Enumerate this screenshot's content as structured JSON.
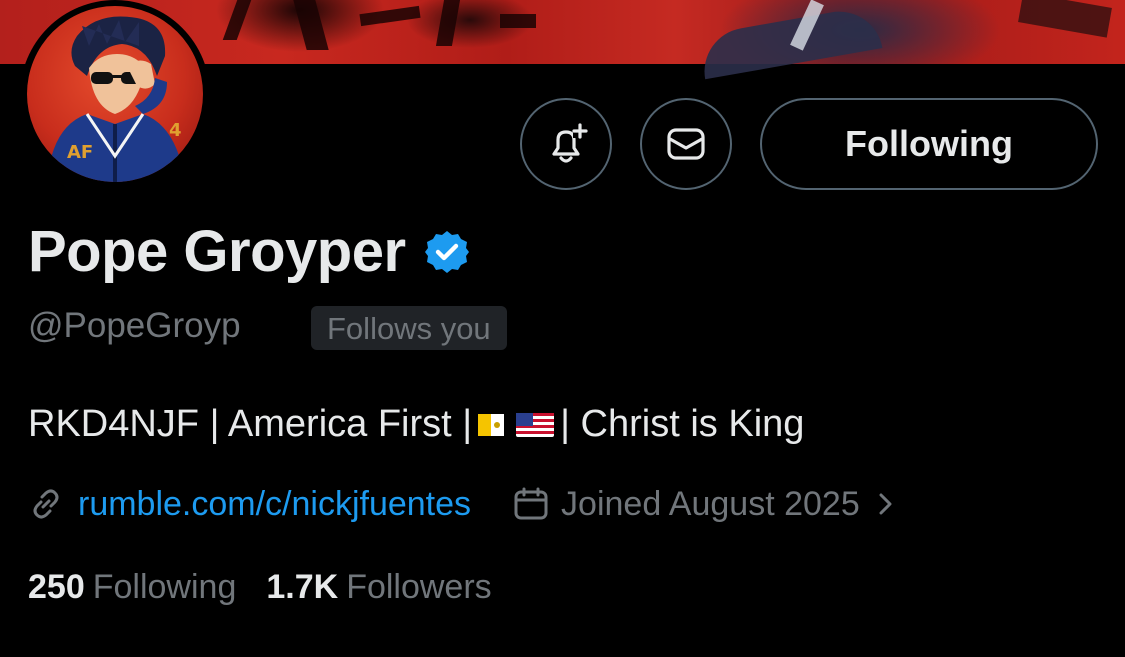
{
  "profile": {
    "display_name": "Pope Groyper",
    "handle": "@PopeGroyp",
    "follows_you": "Follows you",
    "bio_part1": "RKD4NJF | America First |",
    "bio_part2": "| Christ is King",
    "bio_flags": [
      "vatican-flag-icon",
      "us-flag-icon"
    ],
    "website": "rumble.com/c/nickjfuentes",
    "joined": "Joined August 2025",
    "verified": true,
    "verified_color": "#1d9bf0"
  },
  "actions": {
    "notify_icon": "bell-plus-icon",
    "message_icon": "envelope-icon",
    "follow_label": "Following"
  },
  "stats": {
    "following_count": "250",
    "following_label": "Following",
    "followers_count": "1.7K",
    "followers_label": "Followers"
  },
  "avatar_text": {
    "chest": "AF",
    "sleeve": "4"
  },
  "colors": {
    "background": "#000000",
    "primary_text": "#e7e9ea",
    "secondary_text": "#71767b",
    "link": "#1d9bf0",
    "border": "#536471",
    "banner_red": "#c3241c"
  }
}
